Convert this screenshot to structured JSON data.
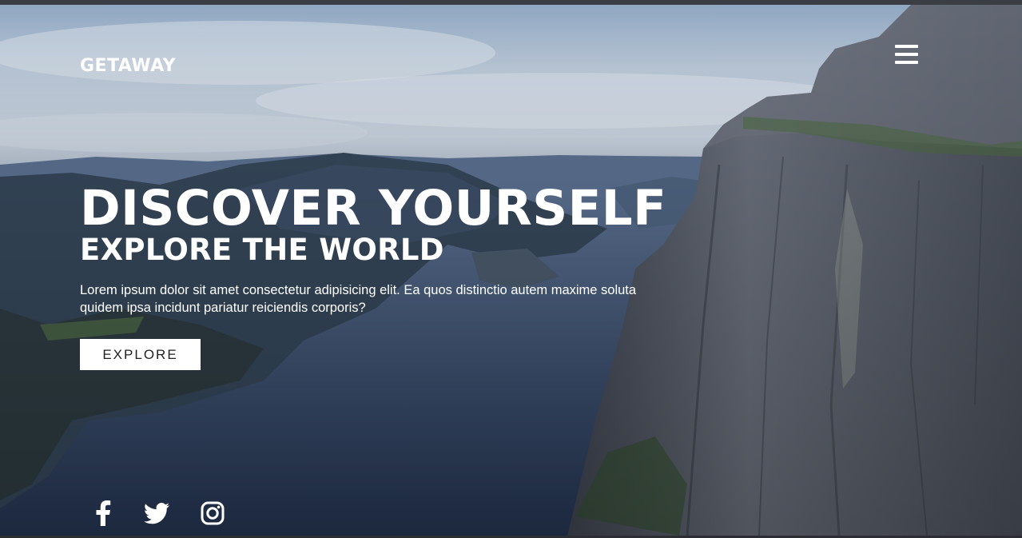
{
  "header": {
    "brand": "GETAWAY",
    "menu_icon": "hamburger-menu-icon"
  },
  "hero": {
    "headline": "DISCOVER YOURSELF",
    "subheadline": "EXPLORE THE WORLD",
    "description": "Lorem ipsum dolor sit amet consectetur adipisicing elit. Ea quos distinctio autem maxime soluta quidem ipsa incidunt pariatur reiciendis corporis?",
    "button_label": "EXPLORE",
    "background": "fjord-cliff-landscape-photo"
  },
  "social": [
    {
      "icon": "facebook-icon"
    },
    {
      "icon": "twitter-icon"
    },
    {
      "icon": "instagram-icon"
    }
  ],
  "colors": {
    "text": "#ffffff",
    "button_bg": "#ffffff",
    "button_text": "#222222",
    "sky": "#b7c6d8",
    "water": "#34476a",
    "cliff": "#5d6370"
  }
}
